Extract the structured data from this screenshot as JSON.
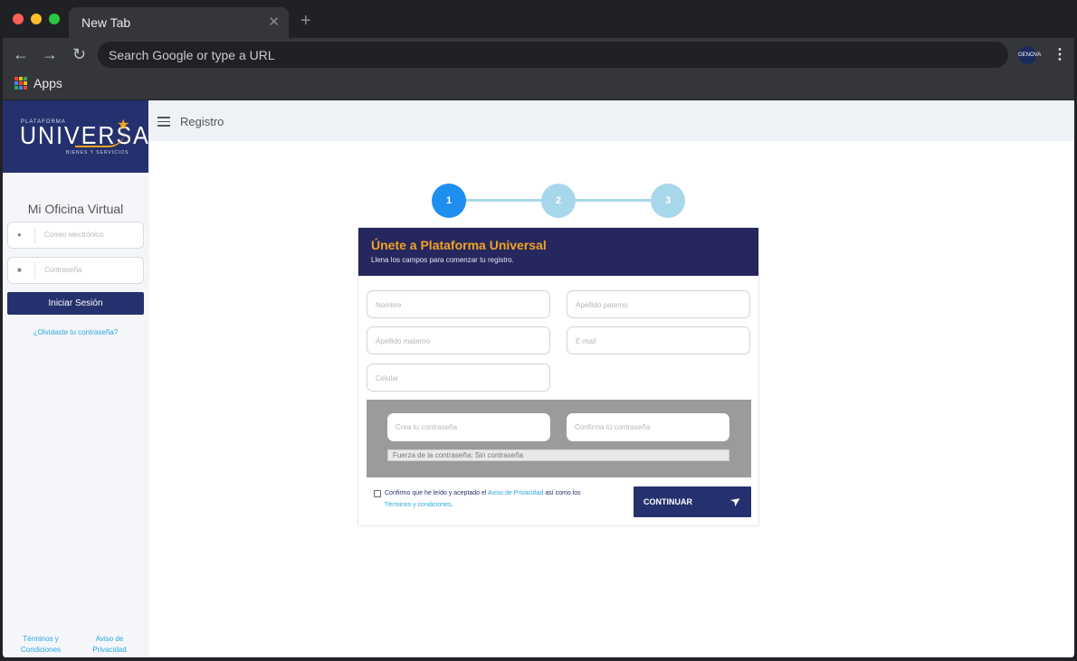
{
  "browser": {
    "tab_title": "New Tab",
    "tab_close": "✕",
    "new_tab": "+",
    "omnibox_placeholder": "Search Google or type a URL",
    "bookmark_apps": "Apps",
    "profile_badge": "GENOVA"
  },
  "sidebar": {
    "logo_small": "PLATAFORMA",
    "logo_main": "UNIVERSAL",
    "logo_sub": "BIENES Y SERVICIOS",
    "title": "Mi Oficina Virtual",
    "email_placeholder": "Correo electrónico",
    "password_placeholder": "Contraseña",
    "login_button": "Iniciar Sesión",
    "forgot_link": "¿Olvidaste tu contraseña?",
    "footer_terms": "Términos y Condiciones",
    "footer_privacy": "Aviso de Privacidad"
  },
  "header": {
    "title": "Registro"
  },
  "stepper": {
    "steps": [
      "1",
      "2",
      "3"
    ],
    "active": 1
  },
  "card": {
    "title": "Únete a Plataforma Universal",
    "subtitle": "Llena los campos para comenzar tu registro.",
    "fields": {
      "nombre": "Nombre",
      "apellido_paterno": "Apellido paterno",
      "apellido_materno": "Apellido materno",
      "email": "E-mail",
      "celular": "Celular"
    },
    "password": {
      "create_placeholder": "Crea tu contraseña",
      "confirm_placeholder": "Confirma tú contraseña",
      "strength": "Fuerza de la contraseña: Sin contraseña"
    },
    "consent": {
      "prefix": "Confirmo que he leído y aceptado el ",
      "privacy_link": "Aviso de Privacidad",
      "middle": " así como los ",
      "terms_link": "Términos y condiciones",
      "suffix": "."
    },
    "continue_button": "CONTINUAR"
  },
  "colors": {
    "brand_navy": "#25316e",
    "brand_orange": "#f3a221",
    "step_active": "#1f8ef1",
    "step_inactive": "#a7d7ea",
    "link": "#29a7df"
  },
  "icons": {
    "back": "arrow-left-icon",
    "forward": "arrow-right-icon",
    "reload": "reload-icon",
    "menu": "hamburger-icon",
    "user": "user-icon",
    "lock": "lock-icon",
    "send": "paper-plane-icon"
  }
}
